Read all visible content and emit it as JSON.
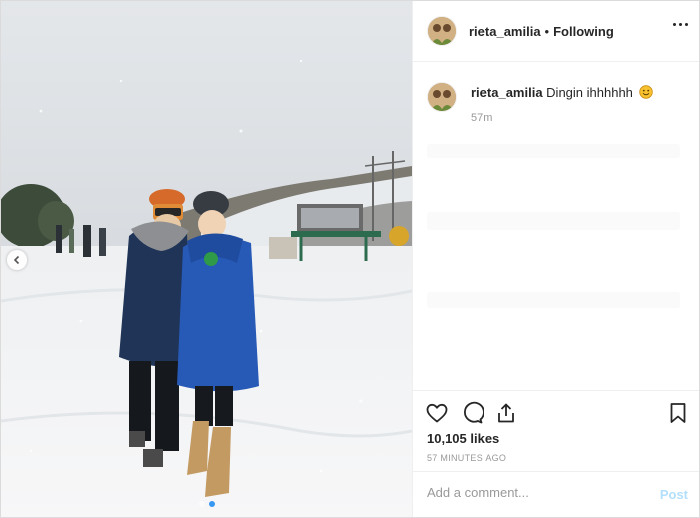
{
  "post": {
    "username": "rieta_amilia",
    "separator": "•",
    "follow_status": "Following",
    "caption_text": "Dingin ihhhhhh",
    "caption_emoji": "smiling-face-icon",
    "caption_time": "57m",
    "likes": "10,105 likes",
    "timestamp": "57 minutes ago",
    "comment_placeholder": "Add a comment...",
    "post_label": "Post"
  },
  "photo": {
    "carousel_total": 2,
    "carousel_active": 2
  },
  "icons": {
    "more": "more-options-icon",
    "like": "heart-icon",
    "comment": "comment-bubble-icon",
    "share": "share-icon",
    "save": "bookmark-icon",
    "prev": "chevron-left-icon"
  },
  "colors": {
    "post_button": "#b2dffc",
    "active_dot": "#3897f0",
    "text": "#262626",
    "muted": "#999999"
  }
}
